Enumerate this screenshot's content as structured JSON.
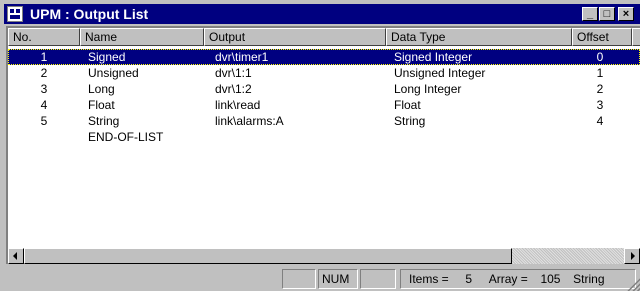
{
  "window": {
    "title": "UPM : Output List",
    "app_icon": "upm-app-icon",
    "buttons": {
      "minimize": "_",
      "maximize": "□",
      "close": "×"
    }
  },
  "list": {
    "columns": [
      "No.",
      "Name",
      "Output",
      "Data Type",
      "Offset"
    ],
    "rows": [
      {
        "no": "1",
        "name": "Signed",
        "output": "dvr\\timer1",
        "type": "Signed Integer",
        "offset": "0"
      },
      {
        "no": "2",
        "name": "Unsigned",
        "output": "dvr\\1:1",
        "type": "Unsigned Integer",
        "offset": "1"
      },
      {
        "no": "3",
        "name": "Long",
        "output": "dvr\\1:2",
        "type": "Long Integer",
        "offset": "2"
      },
      {
        "no": "4",
        "name": "Float",
        "output": "link\\read",
        "type": "Float",
        "offset": "3"
      },
      {
        "no": "5",
        "name": "String",
        "output": "link\\alarms:A",
        "type": "String",
        "offset": "4"
      },
      {
        "no": "",
        "name": "END-OF-LIST",
        "output": "",
        "type": "",
        "offset": ""
      }
    ],
    "selected_index": 0
  },
  "statusbar": {
    "num": "NUM",
    "items_label": "Items =",
    "items_value": "5",
    "array_label": "Array =",
    "array_value": "105",
    "type_value": "String"
  },
  "colors": {
    "titlebar": "#000080",
    "selection": "#000080",
    "face": "#c0c0c0"
  }
}
